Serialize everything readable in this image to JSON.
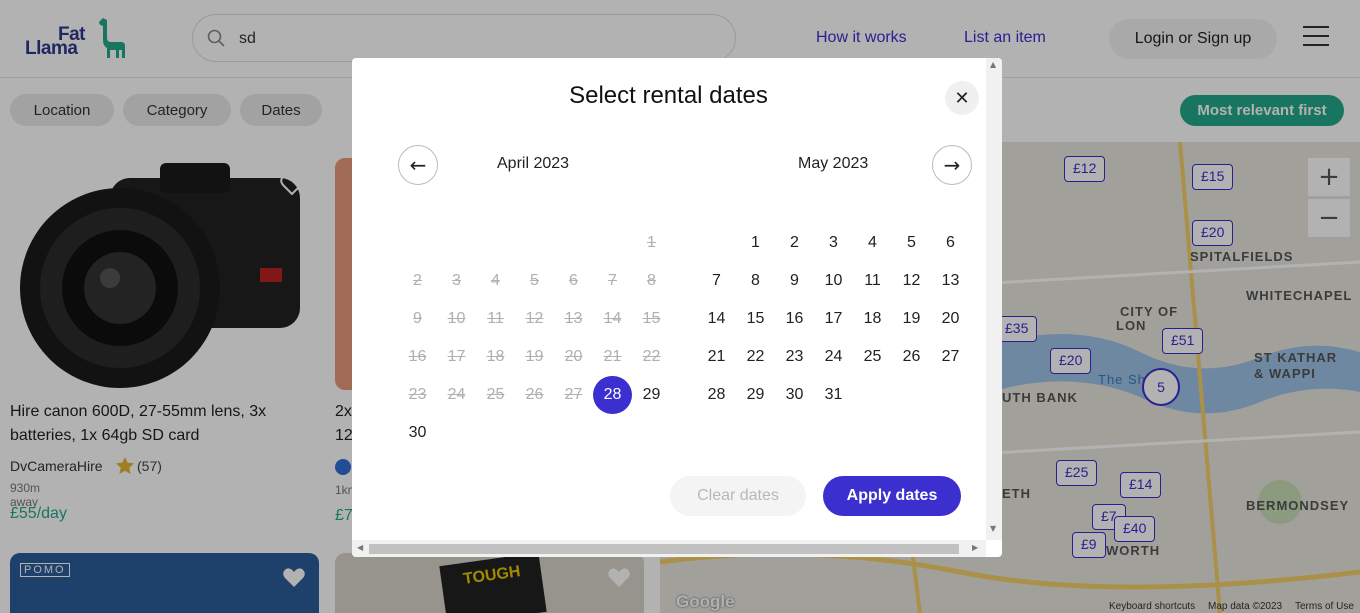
{
  "header": {
    "logo_line1": "Fat",
    "logo_line2": "Llama",
    "search_value": "sd",
    "how_it_works": "How it works",
    "list_an_item": "List an item",
    "login": "Login or Sign up"
  },
  "filters": {
    "location": "Location",
    "category": "Category",
    "dates": "Dates",
    "sort": "Most relevant first"
  },
  "listings": [
    {
      "title": "Hire canon 600D, 27-55mm lens, 3x batteries, 1x 64gb SD card",
      "owner": "DvCameraHire",
      "rating": "(57)",
      "distance": "930m away",
      "price": "£55/day"
    },
    {
      "title_prefix": "2x",
      "title_prefix2": "12",
      "distance_prefix": "1km",
      "price_prefix": "£7"
    }
  ],
  "thumb_labels": {
    "pomo": "POMO",
    "tough": "TOUGH"
  },
  "map": {
    "labels": [
      "SPITALFIELDS",
      "WHITECHAPEL",
      "CITY OF",
      "LON",
      "ST KATHAR",
      "& WAPPI",
      "The Sha",
      "UTH BANK",
      "ETH",
      "BERMONDSEY",
      "WORTH"
    ],
    "pins": [
      "£12",
      "£15",
      "£20",
      "£35",
      "£51",
      "£20",
      "£25",
      "£14",
      "£7",
      "£40",
      "£9"
    ],
    "cluster": "5",
    "google": "Google",
    "footer": [
      "Keyboard shortcuts",
      "Map data ©2023",
      "Terms of Use"
    ]
  },
  "modal": {
    "title": "Select rental dates",
    "months": [
      {
        "name": "April 2023",
        "days": [
          "1",
          "2",
          "3",
          "4",
          "5",
          "6",
          "7",
          "8",
          "9",
          "10",
          "11",
          "12",
          "13",
          "14",
          "15",
          "16",
          "17",
          "18",
          "19",
          "20",
          "21",
          "22",
          "23",
          "24",
          "25",
          "26",
          "27",
          "28",
          "29",
          "30"
        ]
      },
      {
        "name": "May 2023",
        "days": [
          "1",
          "2",
          "3",
          "4",
          "5",
          "6",
          "7",
          "8",
          "9",
          "10",
          "11",
          "12",
          "13",
          "14",
          "15",
          "16",
          "17",
          "18",
          "19",
          "20",
          "21",
          "22",
          "23",
          "24",
          "25",
          "26",
          "27",
          "28",
          "29",
          "30",
          "31"
        ]
      }
    ],
    "selected": "28",
    "clear": "Clear dates",
    "apply": "Apply dates"
  },
  "colors": {
    "brand": "#3b2fcf",
    "accent_green": "#23a98a"
  }
}
